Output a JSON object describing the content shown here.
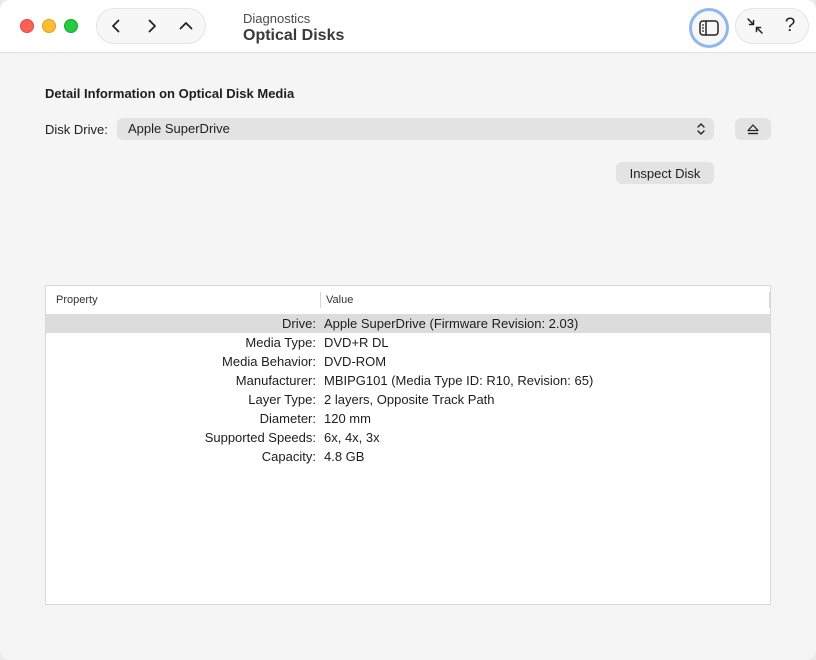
{
  "header": {
    "subtitle": "Diagnostics",
    "title": "Optical Disks",
    "help_label": "?"
  },
  "main": {
    "section_title": "Detail Information on Optical Disk Media",
    "drive_label": "Disk Drive:",
    "drive_selected": "Apple SuperDrive",
    "inspect_label": "Inspect Disk"
  },
  "table": {
    "columns": [
      "Property",
      "Value"
    ],
    "rows": [
      {
        "property": "Drive:",
        "value": "Apple SuperDrive (Firmware Revision: 2.03)",
        "selected": true
      },
      {
        "property": "Media Type:",
        "value": "DVD+R DL"
      },
      {
        "property": "Media Behavior:",
        "value": "DVD-ROM"
      },
      {
        "property": "Manufacturer:",
        "value": "MBIPG101 (Media Type ID: R10, Revision: 65)"
      },
      {
        "property": "Layer Type:",
        "value": "2 layers, Opposite Track Path"
      },
      {
        "property": "Diameter:",
        "value": "120 mm"
      },
      {
        "property": "Supported Speeds:",
        "value": "6x, 4x, 3x"
      },
      {
        "property": "Capacity:",
        "value": "4.8 GB"
      }
    ]
  },
  "icons": {
    "back": "chevron-left-icon",
    "forward": "chevron-right-icon",
    "up": "chevron-up-icon",
    "sidebar": "sidebar-toggle-icon",
    "collapse": "collapse-arrows-icon",
    "eject": "eject-icon",
    "popup": "popup-chevrons-icon"
  }
}
